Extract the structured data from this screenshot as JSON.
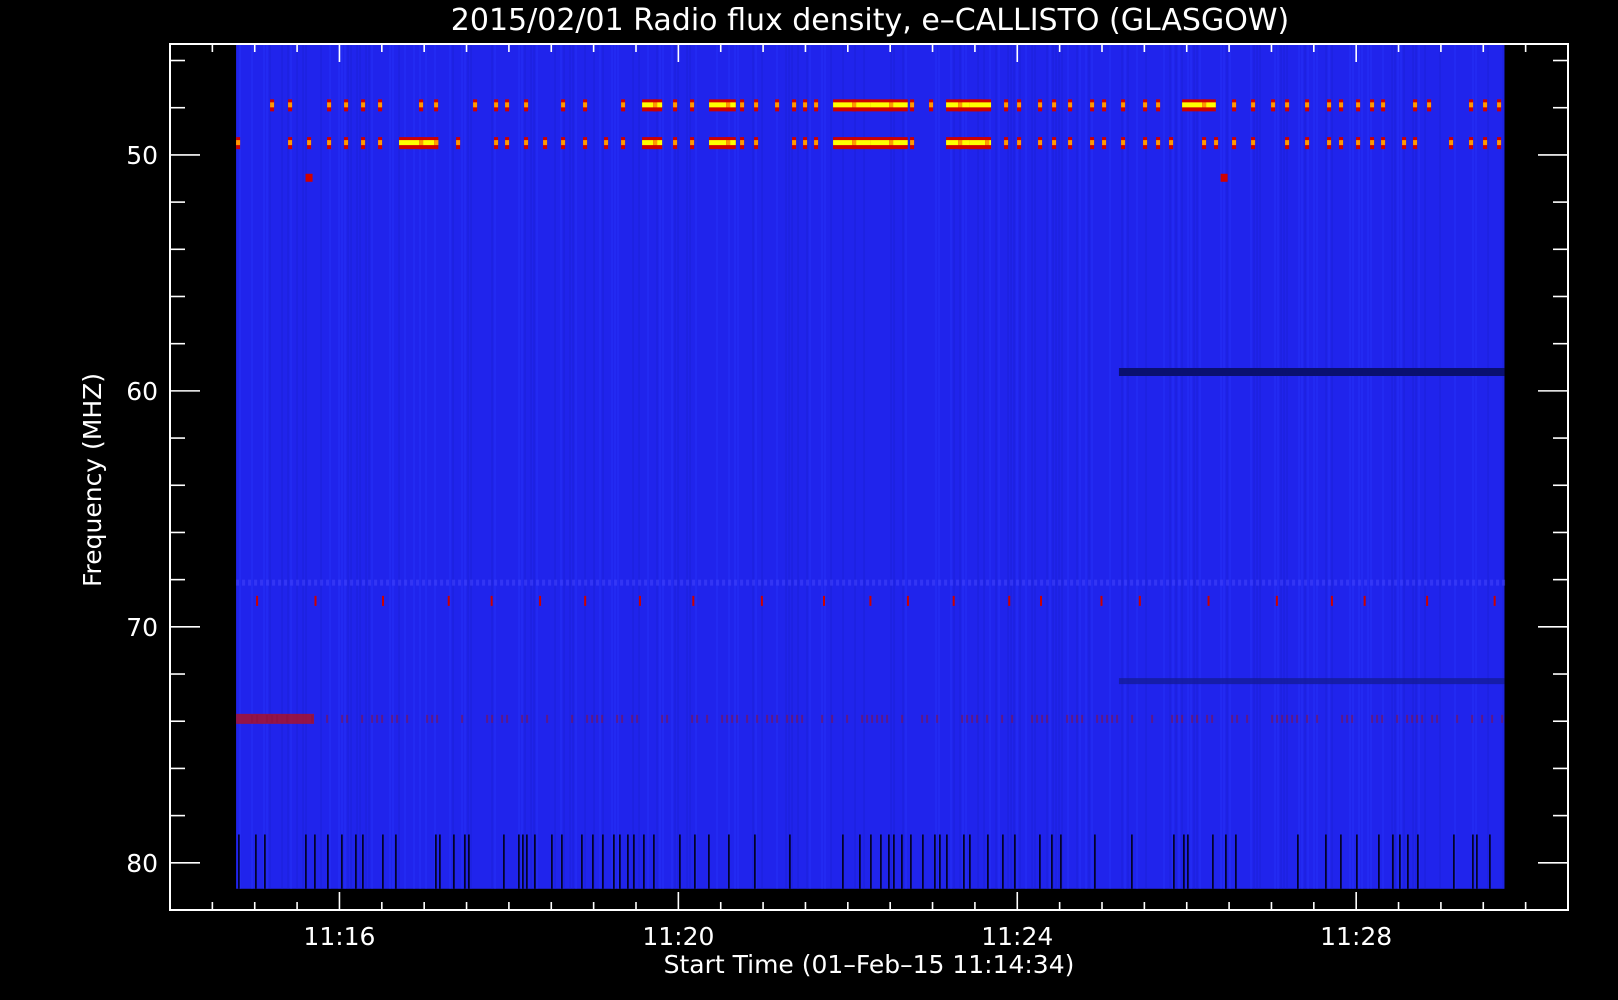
{
  "chart_data": {
    "type": "heatmap",
    "title": "2015/02/01  Radio flux density, e–CALLISTO (GLASGOW)",
    "xlabel": "Start Time (01–Feb–15 11:14:34)",
    "ylabel": "Frequency (MHZ)",
    "x_unit": "minutes",
    "x_tick_labels": [
      "11:16",
      "11:20",
      "11:24",
      "11:28"
    ],
    "x_ticks_min": [
      676,
      680,
      684,
      688
    ],
    "xlim_min": [
      674.0,
      690.5
    ],
    "data_xlim_min": [
      674.78,
      689.75
    ],
    "y_unit": "MHz",
    "y_tick_labels": [
      "50",
      "60",
      "70",
      "80"
    ],
    "y_ticks": [
      50,
      60,
      70,
      80
    ],
    "ylim": [
      45.3,
      82.0
    ],
    "data_ylim": [
      45.3,
      81.1
    ],
    "y_inverted": true,
    "colormap": [
      "#000000",
      "#0000b0",
      "#2030ff",
      "#cc0000",
      "#ff6a00",
      "#ffff00"
    ],
    "background_color": "#2024ec",
    "features": [
      {
        "name": "bursty interference",
        "freq_mhz": [
          47.6,
          49.8
        ],
        "time_min": [
          674.78,
          689.75
        ],
        "color": "#ffcc00"
      },
      {
        "name": "narrow dark band",
        "freq_mhz": 59.2,
        "time_min": [
          685.2,
          689.75
        ],
        "color": "#0a1070"
      },
      {
        "name": "faint red band",
        "freq_mhz": 73.9,
        "time_min": [
          674.78,
          675.7
        ],
        "color": "#b01020"
      },
      {
        "name": "dropouts",
        "freq_mhz": [
          78.8,
          81.1
        ],
        "time_min": [
          674.78,
          689.75
        ],
        "color": "#000018"
      }
    ]
  }
}
